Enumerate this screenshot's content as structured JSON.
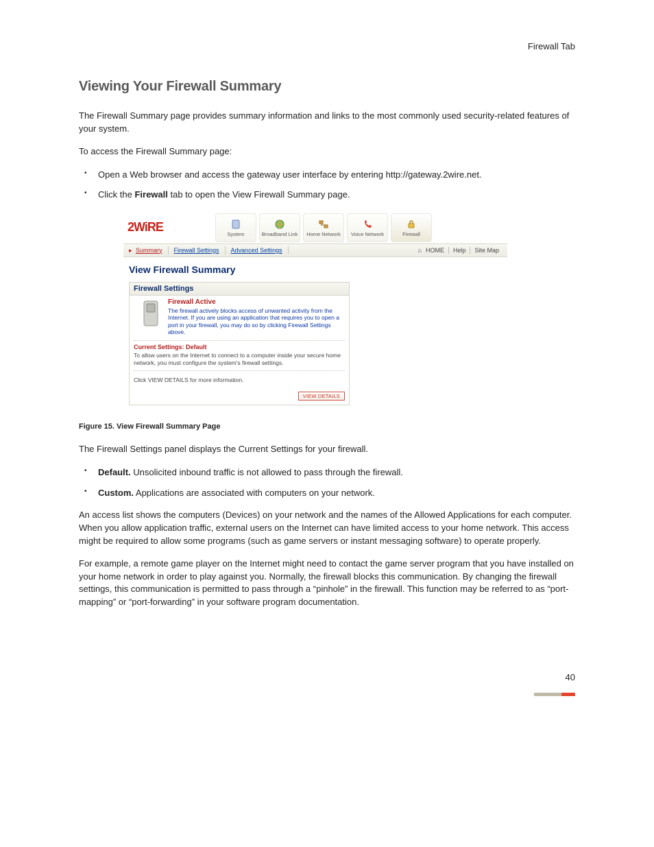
{
  "header_right": "Firewall Tab",
  "title": "Viewing Your Firewall Summary",
  "intro": "The Firewall Summary page provides summary information and links to the most commonly used security-related features of your system.",
  "access_lead": "To access the Firewall Summary page:",
  "bullets1": {
    "b1": "Open a Web browser and access the gateway user interface by entering http://gateway.2wire.net.",
    "b2_pre": "Click the ",
    "b2_bold": "Firewall",
    "b2_post": " tab to open the View Firewall Summary page."
  },
  "shot": {
    "logo": "2WiRE",
    "nav": {
      "system": "System",
      "broadband": "Broadband Link",
      "home": "Home Network",
      "voice": "Voice Network",
      "firewall": "Firewall"
    },
    "subnav": {
      "summary": "Summary",
      "fwset": "Firewall Settings",
      "adv": "Advanced Settings",
      "home": "HOME",
      "help": "Help",
      "sitemap": "Site Map"
    },
    "page_title": "View Firewall Summary",
    "panel_title": "Firewall Settings",
    "fa_title": "Firewall Active",
    "fa_body": "The firewall actively blocks access of unwanted activity from the Internet. If you are using an application that requires you to open a port in your firewall, you may do so by clicking Firewall Settings above.",
    "cs_title": "Current Settings: Default",
    "cs_body": "To allow users on the Internet to connect to a computer inside your secure home network, you must configure the system's firewall settings.",
    "more_info": "Click VIEW DETAILS for more information.",
    "view_details": "VIEW DETAILS"
  },
  "figure_caption": "Figure 15. View Firewall Summary Page",
  "after_fig": "The Firewall Settings panel displays the Current Settings for your firewall.",
  "bullets2": {
    "d_bold": "Default.",
    "d_rest": " Unsolicited inbound traffic is not allowed to pass through the firewall.",
    "c_bold": "Custom.",
    "c_rest": " Applications are associated with computers on your network."
  },
  "para2": "An access list shows the computers (Devices) on your network and the names of the Allowed Applications for each computer. When you allow application traffic, external users on the Internet can have limited access to your home network. This access might be required to allow some programs (such as game servers or instant messaging software) to operate properly.",
  "para3": "For example, a remote game player on the Internet might need to contact the game server program that you have installed on your home network in order to play against you. Normally, the firewall blocks this communication. By changing the firewall settings, this communication is permitted to pass through a “pinhole” in the firewall. This function may be referred to as “port-mapping” or “port-forwarding” in your software program documentation.",
  "page_number": "40"
}
